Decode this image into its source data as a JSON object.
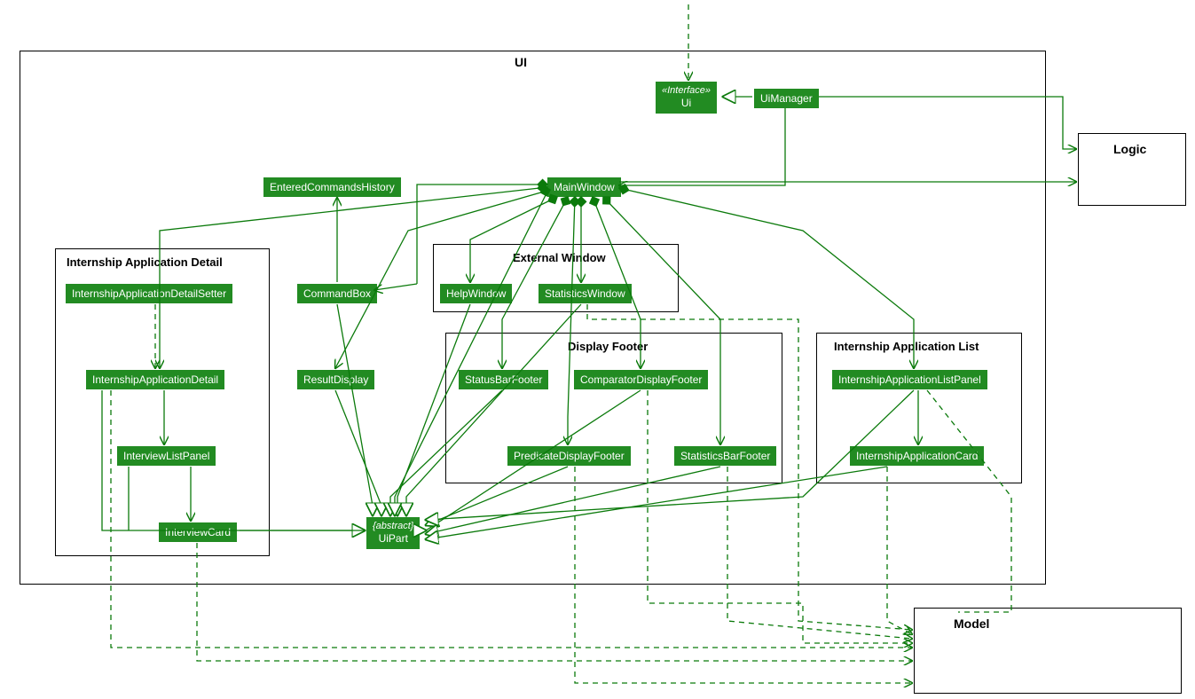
{
  "packages": {
    "ui": {
      "label": "UI"
    },
    "logic": {
      "label": "Logic"
    },
    "model": {
      "label": "Model"
    }
  },
  "groups": {
    "detail": {
      "label": "Internship Application Detail"
    },
    "extwin": {
      "label": "External Window"
    },
    "footer": {
      "label": "Display Footer"
    },
    "applist": {
      "label": "Internship Application List"
    }
  },
  "classes": {
    "ui_iface": {
      "stereo": "«Interface»",
      "name": "Ui"
    },
    "uimanager": {
      "name": "UiManager"
    },
    "entered": {
      "name": "EnteredCommandsHistory"
    },
    "mainwindow": {
      "name": "MainWindow"
    },
    "detailsetter": {
      "name": "InternshipApplicationDetailSetter"
    },
    "commandbox": {
      "name": "CommandBox"
    },
    "helpwin": {
      "name": "HelpWindow"
    },
    "statswin": {
      "name": "StatisticsWindow"
    },
    "appdetail": {
      "name": "InternshipApplicationDetail"
    },
    "resultdisp": {
      "name": "ResultDisplay"
    },
    "statusbar": {
      "name": "StatusBarFooter"
    },
    "compfooter": {
      "name": "ComparatorDisplayFooter"
    },
    "listpanel": {
      "name": "InternshipApplicationListPanel"
    },
    "ivlist": {
      "name": "InterviewListPanel"
    },
    "predfooter": {
      "name": "PredicateDisplayFooter"
    },
    "statsbar": {
      "name": "StatisticsBarFooter"
    },
    "appcard": {
      "name": "InternshipApplicationCard"
    },
    "ivcard": {
      "name": "InterviewCard"
    },
    "uipart": {
      "stereo": "{abstract}",
      "name": "UiPart"
    }
  },
  "colors": {
    "class_fill": "#228b22",
    "class_text": "#ffffff",
    "line": "#0b7a0b"
  }
}
